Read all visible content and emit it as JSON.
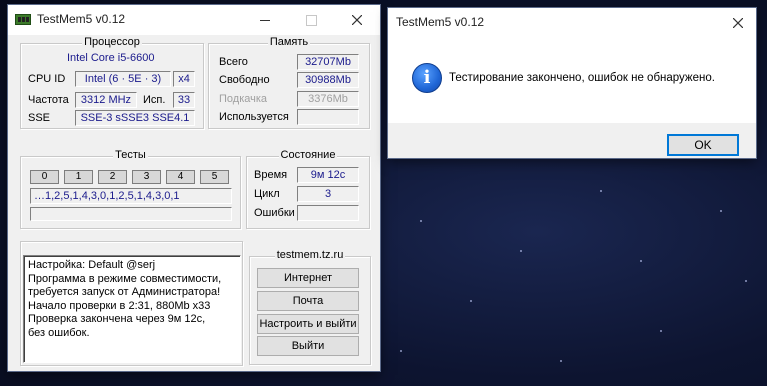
{
  "main_window": {
    "title": "TestMem5 v0.12",
    "processor": {
      "title": "Процессор",
      "name": "Intel Core i5-6600",
      "cpuid_label": "CPU ID",
      "cpuid_value": "Intel (6 · 5E · 3)",
      "threads": "x4",
      "freq_label": "Частота",
      "freq_value": "3312 MHz",
      "use_label": "Исп.",
      "use_value": "33",
      "sse_label": "SSE",
      "sse_value": "SSE-3 sSSE3 SSE4.1"
    },
    "memory": {
      "title": "Память",
      "total_label": "Всего",
      "total_value": "32707Mb",
      "free_label": "Свободно",
      "free_value": "30988Mb",
      "swap_label": "Подкачка",
      "swap_value": "3376Mb",
      "used_label": "Используется",
      "used_value": ""
    },
    "tests": {
      "title": "Тесты",
      "cells": [
        "0",
        "1",
        "2",
        "3",
        "4",
        "5"
      ],
      "sequence": "…1,2,5,1,4,3,0,1,2,5,1,4,3,0,1"
    },
    "status": {
      "title": "Состояние",
      "time_label": "Время",
      "time_value": "9м 12с",
      "cycle_label": "Цикл",
      "cycle_value": "3",
      "errors_label": "Ошибки",
      "errors_value": ""
    },
    "log_lines": [
      "Настройка: Default @serj",
      "Программа в режиме совместимости,",
      "требуется запуск от Администратора!",
      "Начало проверки в 2:31, 880Mb x33",
      "Проверка закончена через 9м 12с,",
      "без ошибок."
    ],
    "site": {
      "title": "testmem.tz.ru",
      "internet_button": "Интернет",
      "mail_button": "Почта",
      "config_exit_button": "Настроить и выйти",
      "exit_button": "Выйти"
    }
  },
  "dialog": {
    "title": "TestMem5 v0.12",
    "icon": "info-icon",
    "message": "Тестирование закончено, ошибок не обнаружено.",
    "ok_button": "OK"
  },
  "icons": {
    "app": "memory-chip-icon",
    "minimize": "minimize-icon",
    "maximize": "maximize-icon",
    "close": "close-icon"
  }
}
